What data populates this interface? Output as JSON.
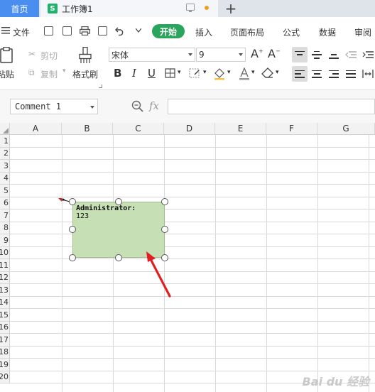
{
  "titlebar": {
    "home_tab": "首页",
    "doc_tab": "工作簿1",
    "doc_logo": "S",
    "new_tab_symbol": "+"
  },
  "menubar": {
    "file": "文件",
    "start": "开始",
    "insert": "插入",
    "page_layout": "页面布局",
    "formula": "公式",
    "data": "数据",
    "review": "审阅"
  },
  "ribbon": {
    "paste": "粘贴",
    "cut": "剪切",
    "copy": "复制",
    "format_painter": "格式刷",
    "font_name": "宋体",
    "font_size": "9",
    "bold": "B",
    "italic": "I",
    "underline": "U",
    "grow_font": "A",
    "shrink_font": "A"
  },
  "formulabar": {
    "name_box": "Comment 1",
    "fx": "fx",
    "formula_value": ""
  },
  "grid": {
    "columns": [
      "A",
      "B",
      "C",
      "D",
      "E",
      "F",
      "G"
    ],
    "rows": [
      "1",
      "2",
      "3",
      "4",
      "5",
      "6",
      "7",
      "8",
      "9",
      "10",
      "11",
      "12",
      "13",
      "14",
      "15",
      "16",
      "17",
      "18",
      "19",
      "20"
    ]
  },
  "comment": {
    "author": "Administrator:",
    "text": "123",
    "fill_color": "#c6dfb4"
  },
  "annotation": {
    "arrow_color": "#e02020"
  },
  "watermark": "Bai du 经验"
}
